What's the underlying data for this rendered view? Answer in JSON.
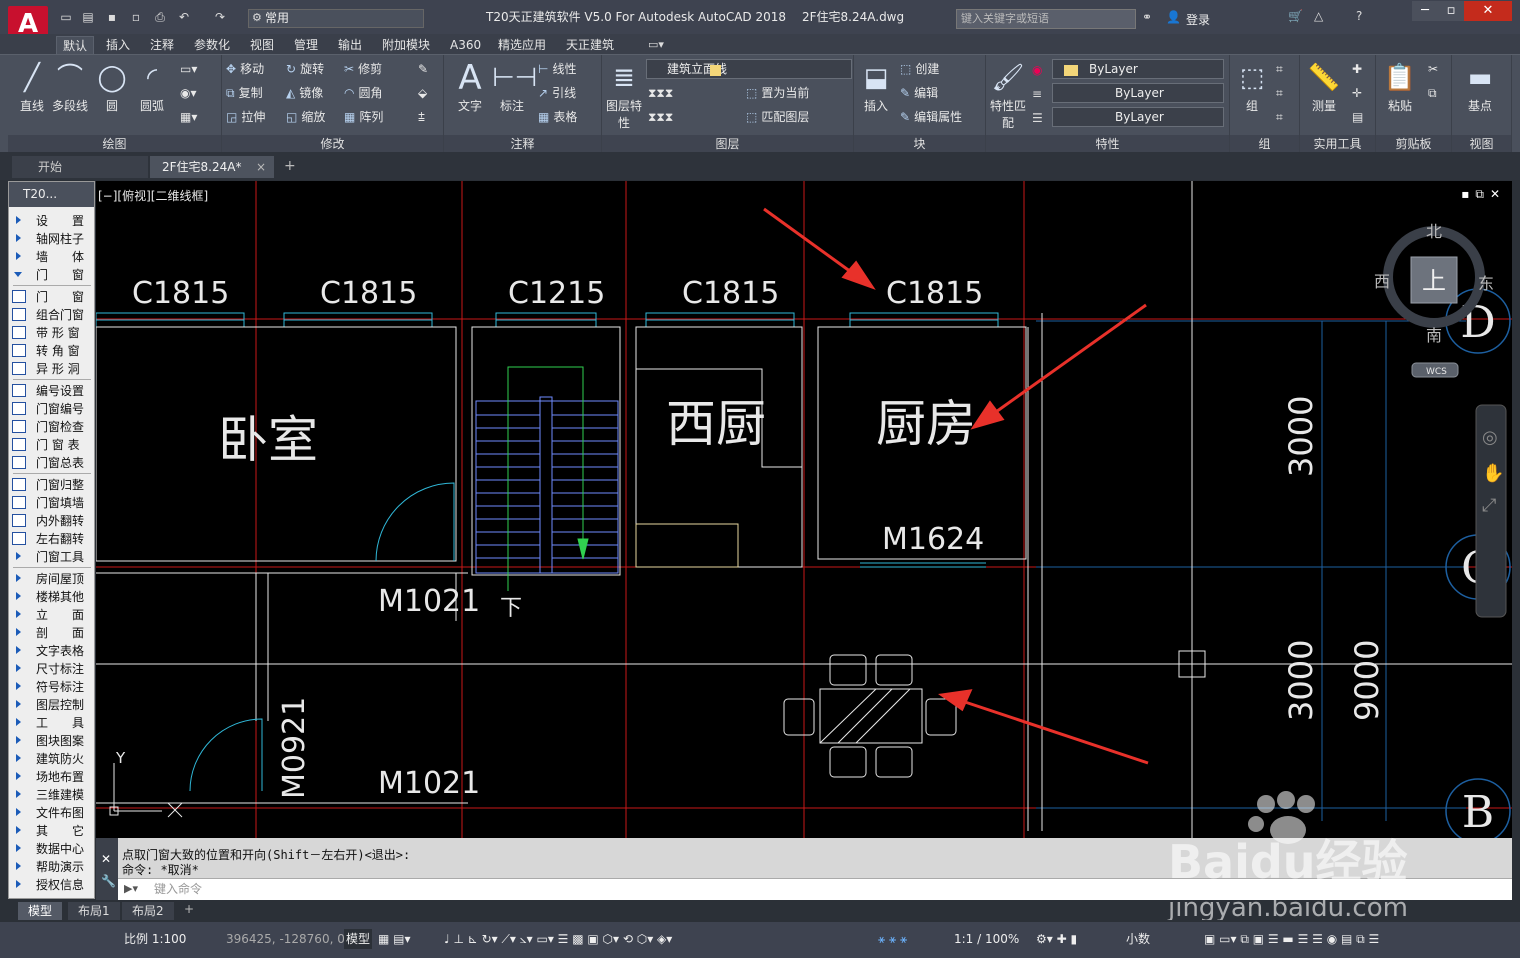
{
  "titlebar": {
    "logo": "A",
    "workspace": "常用",
    "app_title": "T20天正建筑软件 V5.0 For Autodesk AutoCAD 2018",
    "doc_title": "2F住宅8.24A.dwg",
    "search_placeholder": "键入关键字或短语",
    "login": "登录"
  },
  "ribbon_tabs": [
    "默认",
    "插入",
    "注释",
    "参数化",
    "视图",
    "管理",
    "输出",
    "附加模块",
    "A360",
    "精选应用",
    "天正建筑"
  ],
  "ribbon": {
    "draw": {
      "title": "绘图",
      "line": "直线",
      "polyline": "多段线",
      "circle": "圆",
      "arc": "圆弧"
    },
    "modify": {
      "title": "修改",
      "move": "移动",
      "rotate": "旋转",
      "trim": "修剪",
      "copy": "复制",
      "mirror": "镜像",
      "fillet": "圆角",
      "stretch": "拉伸",
      "scale": "缩放",
      "array": "阵列"
    },
    "annotation": {
      "title": "注释",
      "text": "文字",
      "dimension": "标注",
      "linear": "线性",
      "leader": "引线",
      "table": "表格"
    },
    "layers": {
      "title": "图层",
      "props": "图层特性",
      "current_layer": "建筑立面线",
      "make_current": "置为当前",
      "match": "匹配图层"
    },
    "block": {
      "title": "块",
      "insert": "插入",
      "create": "创建",
      "edit": "编辑",
      "edit_attr": "编辑属性"
    },
    "properties": {
      "title": "特性",
      "match": "特性匹配",
      "color": "ByLayer",
      "linetype": "ByLayer",
      "lineweight": "ByLayer"
    },
    "groups": {
      "title": "组",
      "group": "组"
    },
    "utilities": {
      "title": "实用工具",
      "measure": "测量"
    },
    "clipboard": {
      "title": "剪贴板",
      "paste": "粘贴"
    },
    "view": {
      "title": "视图",
      "base": "基点"
    }
  },
  "doc_tabs": [
    "开始",
    "2F住宅8.24A*"
  ],
  "tz_panel": {
    "header": "T20...",
    "items": [
      "设　　置",
      "轴网柱子",
      "墙　　体",
      "门　　窗"
    ],
    "sub_items": [
      "门　　窗",
      "组合门窗",
      "带 形 窗",
      "转 角 窗",
      "异 形 洞"
    ],
    "sub_items2": [
      "编号设置",
      "门窗编号",
      "门窗检查",
      "门 窗 表",
      "门窗总表"
    ],
    "sub_items3": [
      "门窗归整",
      "门窗填墙",
      "内外翻转",
      "左右翻转",
      "门窗工具"
    ],
    "items2": [
      "房间屋顶",
      "楼梯其他",
      "立　　面",
      "剖　　面",
      "文字表格",
      "尺寸标注",
      "符号标注",
      "图层控制",
      "工　　具",
      "图块图案",
      "建筑防火",
      "场地布置",
      "三维建模",
      "文件布图",
      "其　　它",
      "数据中心",
      "帮助演示",
      "授权信息"
    ]
  },
  "viewport": {
    "label": "[−][俯视][二维线框]",
    "window_labels": [
      "C1815",
      "C1815",
      "C1215",
      "C1815",
      "C1815"
    ],
    "rooms": [
      "卧室",
      "西厨",
      "厨房"
    ],
    "doors": [
      "M1021",
      "M1624",
      "M1021",
      "M0921"
    ],
    "stair_label": "下",
    "dims": [
      "3000",
      "3000",
      "9000"
    ],
    "axes": [
      "D",
      "C",
      "B"
    ],
    "ucs_y": "Y",
    "viewcube": {
      "north": "北",
      "south": "南",
      "east": "东",
      "west": "西",
      "top": "上",
      "wcs": "WCS"
    }
  },
  "command": {
    "history": [
      "点取门窗大致的位置和开向(Shift－左右开)<退出>:",
      "命令: *取消*"
    ],
    "placeholder": "键入命令"
  },
  "layout_tabs": [
    "模型",
    "布局1",
    "布局2"
  ],
  "status": {
    "scale": "比例 1:100",
    "coords": "396425, -128760, 0",
    "model": "模型",
    "annotation_scale": "1:1 / 100%",
    "units": "小数"
  },
  "watermark": {
    "brand": "Baidu经验",
    "url": "jingyan.baidu.com"
  },
  "colors": {
    "accent": "#c8102e",
    "canvas": "#000000",
    "arrow": "#e8312a",
    "wall": "#e8e8e8",
    "axis": "#d01818",
    "window": "#30b8d8"
  }
}
